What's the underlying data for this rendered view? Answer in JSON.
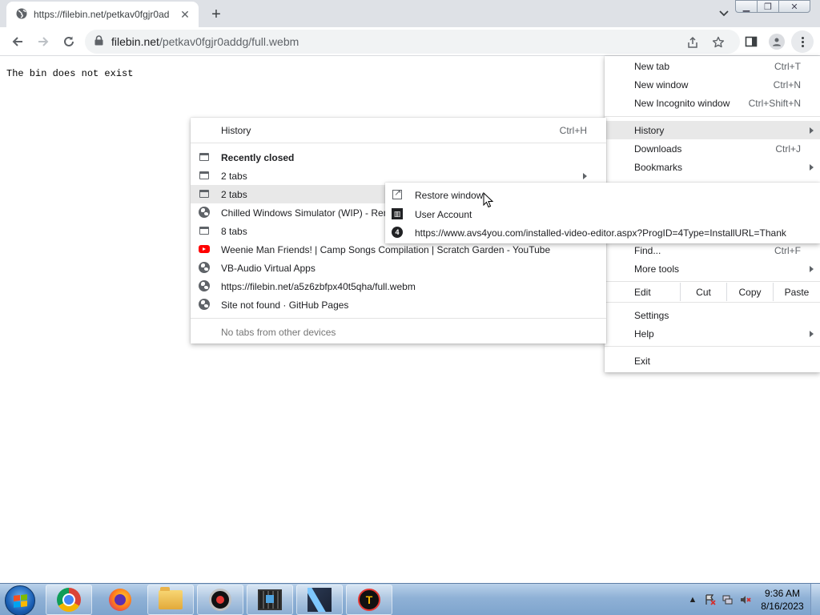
{
  "browser": {
    "tab": {
      "title": "https://filebin.net/petkav0fgjr0ad"
    },
    "address": {
      "domain": "filebin.net",
      "path": "/petkav0fgjr0addg/full.webm"
    }
  },
  "page": {
    "message": "The bin does not exist"
  },
  "main_menu": {
    "items": [
      {
        "label": "New tab",
        "shortcut": "Ctrl+T"
      },
      {
        "label": "New window",
        "shortcut": "Ctrl+N"
      },
      {
        "label": "New Incognito window",
        "shortcut": "Ctrl+Shift+N"
      },
      {
        "label": "History",
        "highlighted": true
      },
      {
        "label": "Downloads",
        "shortcut": "Ctrl+J"
      },
      {
        "label": "Bookmarks"
      },
      {
        "label": "Find...",
        "shortcut": "Ctrl+F"
      },
      {
        "label": "More tools"
      },
      {
        "label": "Settings"
      },
      {
        "label": "Help"
      },
      {
        "label": "Exit"
      }
    ],
    "edit": {
      "label": "Edit",
      "cut": "Cut",
      "copy": "Copy",
      "paste": "Paste"
    }
  },
  "history_menu": {
    "title": "History",
    "title_shortcut": "Ctrl+H",
    "recently_closed": "Recently closed",
    "items": [
      {
        "label": "2 tabs",
        "icon": "window-icon"
      },
      {
        "label": "2 tabs",
        "icon": "window-icon",
        "highlighted": true
      },
      {
        "label": "Chilled Windows Simulator (WIP) - Rem",
        "icon": "globe-icon"
      },
      {
        "label": "8 tabs",
        "icon": "window-icon"
      },
      {
        "label": "Weenie Man  Friends! | Camp Songs Compilation | Scratch Garden - YouTube",
        "icon": "youtube-icon"
      },
      {
        "label": "VB-Audio Virtual Apps",
        "icon": "globe-icon"
      },
      {
        "label": "https://filebin.net/a5z6zbfpx40t5qha/full.webm",
        "icon": "globe-icon"
      },
      {
        "label": "Site not found · GitHub Pages",
        "icon": "globe-icon"
      }
    ],
    "no_other_devices": "No tabs from other devices"
  },
  "tabs_submenu": {
    "items": [
      {
        "label": "Restore window",
        "icon": "open-external-icon"
      },
      {
        "label": "User Account",
        "icon": "bank-icon"
      },
      {
        "label": "https://www.avs4you.com/installed-video-editor.aspx?ProgID=4Type=InstallURL=Thank",
        "icon": "four-icon"
      }
    ]
  },
  "taskbar": {
    "apps": [
      "chrome-icon",
      "firefox-icon",
      "file-explorer-icon",
      "recorder-icon",
      "video-editor-icon",
      "kdenlive-icon",
      "t-app-icon"
    ],
    "clock": {
      "time": "9:36 AM",
      "date": "8/16/2023"
    }
  }
}
